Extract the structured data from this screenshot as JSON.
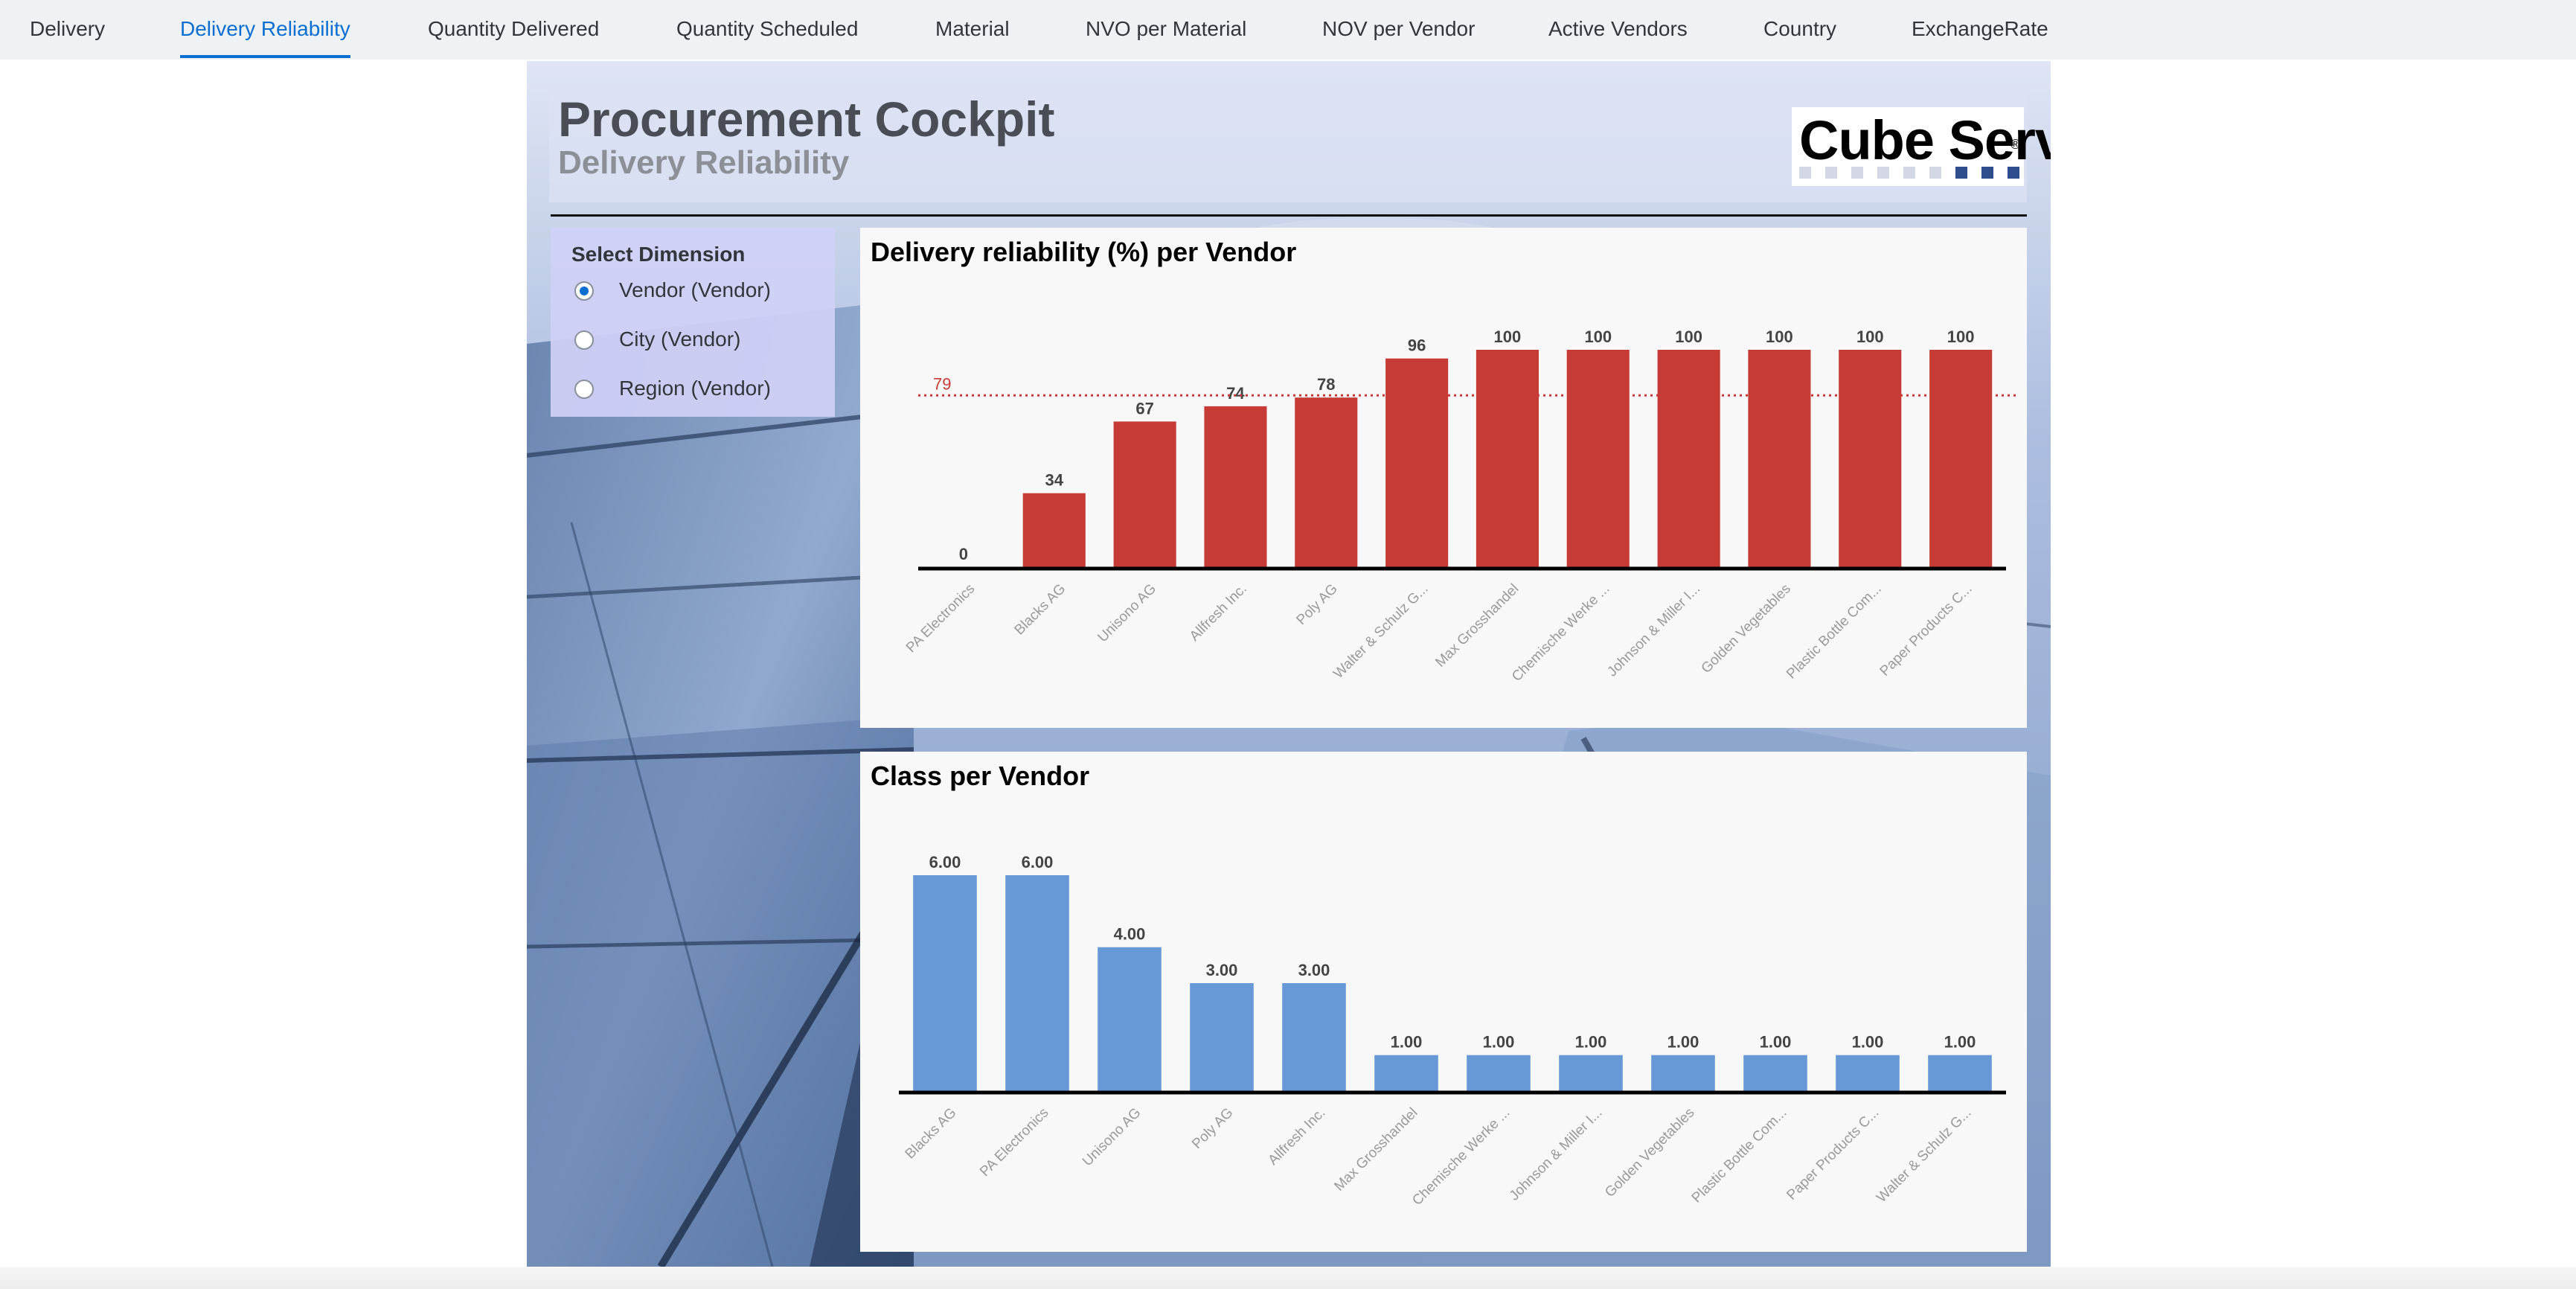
{
  "tabs": [
    {
      "label": "Delivery",
      "selected": false
    },
    {
      "label": "Delivery Reliability",
      "selected": true
    },
    {
      "label": "Quantity Delivered",
      "selected": false
    },
    {
      "label": "Quantity Scheduled",
      "selected": false
    },
    {
      "label": "Material",
      "selected": false
    },
    {
      "label": "NVO per Material",
      "selected": false
    },
    {
      "label": "NOV per Vendor",
      "selected": false
    },
    {
      "label": "Active Vendors",
      "selected": false
    },
    {
      "label": "Country",
      "selected": false
    },
    {
      "label": "ExchangeRate",
      "selected": false
    }
  ],
  "header": {
    "title": "Procurement Cockpit",
    "subtitle": "Delivery Reliability",
    "logo_text": "Cube Serv",
    "logo_mark": "®"
  },
  "colors": {
    "accent": "#0a6ed1",
    "reliability_bar": "#c73b36",
    "class_bar": "#6699d6",
    "average_line": "#c73b36",
    "logo_square_light": "#d4d7e6",
    "logo_square_dark": "#2f4d8c"
  },
  "dimension_selector": {
    "title": "Select Dimension",
    "options": [
      {
        "label": "Vendor (Vendor)",
        "checked": true
      },
      {
        "label": "City (Vendor)",
        "checked": false
      },
      {
        "label": "Region (Vendor)",
        "checked": false
      }
    ]
  },
  "chart_data": [
    {
      "type": "bar",
      "title": "Delivery reliability (%) per Vendor",
      "categories": [
        "PA Electronics",
        "Blacks AG",
        "Unisono AG",
        "Allfresh Inc.",
        "Poly AG",
        "Walter & Schulz G...",
        "Max Grosshandel",
        "Chemische Werke ...",
        "Johnson & Miller I...",
        "Golden Vegetables",
        "Plastic Bottle Com...",
        "Paper Products C..."
      ],
      "values": [
        0,
        34,
        67,
        74,
        78,
        96,
        100,
        100,
        100,
        100,
        100,
        100
      ],
      "value_labels": [
        "0",
        "34",
        "67",
        "74",
        "78",
        "96",
        "100",
        "100",
        "100",
        "100",
        "100",
        "100"
      ],
      "reference_line": {
        "value": 79,
        "label": "79",
        "style": "dotted"
      },
      "ylim": [
        0,
        100
      ],
      "xlabel": "",
      "ylabel": "",
      "grid": false,
      "legend": "none"
    },
    {
      "type": "bar",
      "title": "Class per Vendor",
      "categories": [
        "Blacks AG",
        "PA Electronics",
        "Unisono AG",
        "Poly AG",
        "Allfresh Inc.",
        "Max Grosshandel",
        "Chemische Werke ...",
        "Johnson & Miller I...",
        "Golden Vegetables",
        "Plastic Bottle Com...",
        "Paper Products C...",
        "Walter & Schulz G..."
      ],
      "values": [
        6,
        6,
        4,
        3,
        3,
        1,
        1,
        1,
        1,
        1,
        1,
        1
      ],
      "value_labels": [
        "6.00",
        "6.00",
        "4.00",
        "3.00",
        "3.00",
        "1.00",
        "1.00",
        "1.00",
        "1.00",
        "1.00",
        "1.00",
        "1.00"
      ],
      "ylim": [
        0,
        6
      ],
      "xlabel": "",
      "ylabel": "",
      "grid": false,
      "legend": "none"
    }
  ]
}
